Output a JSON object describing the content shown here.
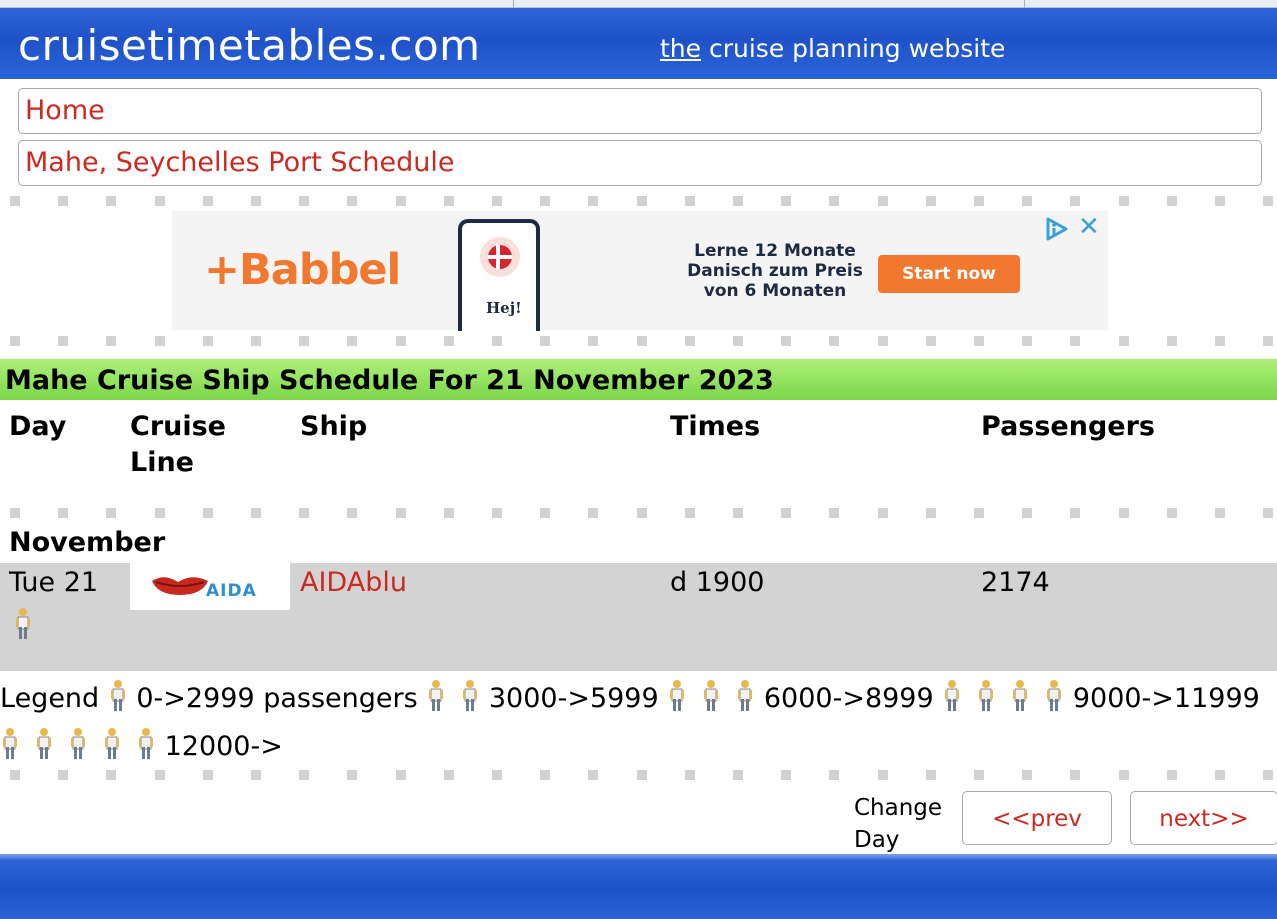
{
  "header": {
    "site_title": "cruisetimetables.com",
    "tagline_the": "the",
    "tagline_rest": " cruise planning website"
  },
  "nav": {
    "home": "Home",
    "port_schedule": "Mahe, Seychelles Port Schedule"
  },
  "ad": {
    "brand": "+Babbel",
    "phone_text": "Hej!",
    "headline": "Lerne 12 Monate Danisch zum Preis von 6 Monaten",
    "cta": "Start now",
    "close_glyph": "✕"
  },
  "schedule": {
    "title": "Mahe Cruise Ship Schedule For 21 November 2023",
    "columns": [
      "Day",
      "Cruise Line",
      "Ship",
      "Times",
      "Passengers"
    ],
    "month": "November",
    "rows": [
      {
        "day": "Tue 21",
        "cruise_line": "AIDA",
        "ship": "AIDAblu",
        "times": "d 1900",
        "passengers": "2174",
        "passenger_icons": 1
      }
    ]
  },
  "legend": {
    "label": "Legend",
    "ranges": [
      "0->2999 passengers",
      "3000->5999",
      "6000->8999",
      "9000->11999",
      "12000->"
    ]
  },
  "pager": {
    "change_day": "Change Day",
    "prev": "<<prev",
    "next": "next>>"
  },
  "colors": {
    "link": "#cc2a21",
    "header_blue": "#1f52c9",
    "title_green": "#7bd64a",
    "row_grey": "#d3d3d3",
    "ad_orange": "#f2782f"
  }
}
